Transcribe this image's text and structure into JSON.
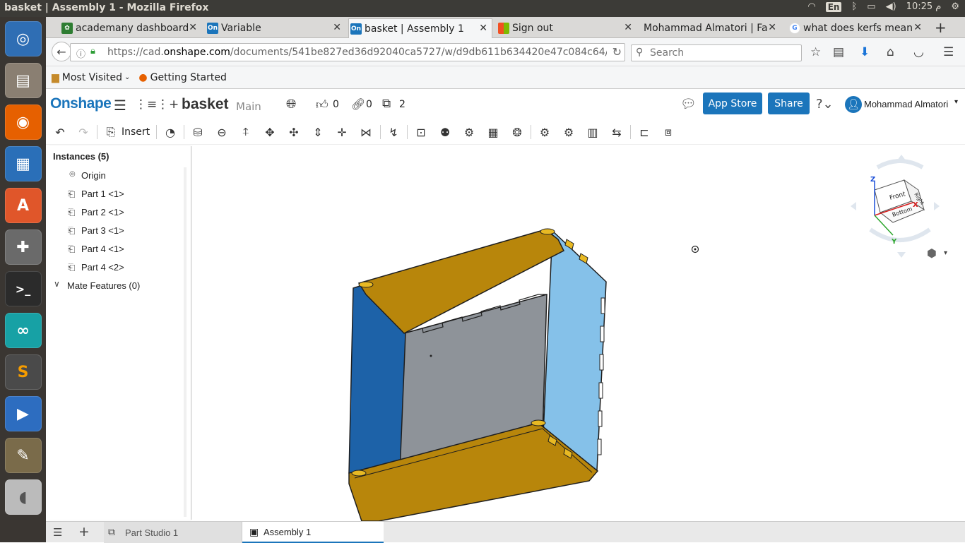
{
  "topbar": {
    "title": "basket | Assembly 1 - Mozilla Firefox",
    "lang": "En",
    "clock": "10:25 م"
  },
  "launcher": [
    "ubuntu-icon",
    "files-icon",
    "firefox-icon",
    "writer-icon",
    "software-center-icon",
    "settings-icon",
    "terminal-icon",
    "arduino-icon",
    "sublime-icon",
    "media-player-icon",
    "gimp-icon",
    "mouse-icon"
  ],
  "tabs": [
    {
      "label": "academany dashboard",
      "color": "#2e7d32"
    },
    {
      "label": "Variable",
      "color": "#1b75bb"
    },
    {
      "label": "basket | Assembly 1",
      "color": "#1b75bb"
    },
    {
      "label": "Sign out",
      "color": "#e44"
    },
    {
      "label": "Mohammad Almatori | Fa",
      "color": ""
    },
    {
      "label": "what does kerfs mean",
      "color": "#4285f4"
    }
  ],
  "nav": {
    "url_prefix": "https://cad.",
    "url_domain": "onshape.com",
    "url_rest": "/documents/541be827ed36d92040ca5727/w/d9db611b634420e47c084c64/",
    "search_placeholder": "Search"
  },
  "bookmarks": {
    "most_visited": "Most Visited",
    "getting_started": "Getting Started"
  },
  "onshape": {
    "logo": "Onshape",
    "doc_name": "basket",
    "branch": "Main",
    "likes": "0",
    "links": "0",
    "copies": "2",
    "app_store": "App Store",
    "share": "Share",
    "user": "Mohammad Almatori"
  },
  "toolbar": {
    "insert": "Insert"
  },
  "panel": {
    "instances_header": "Instances (5)",
    "origin": "Origin",
    "parts": [
      "Part 1 <1>",
      "Part 2 <1>",
      "Part 3 <1>",
      "Part 4 <1>",
      "Part 4 <2>"
    ],
    "mate_features": "Mate Features (0)"
  },
  "viewcube": {
    "z": "Z",
    "x": "X",
    "y": "Y",
    "front": "Front",
    "right": "Right",
    "bottom": "Bottom"
  },
  "bottom_tabs": {
    "part_studio": "Part Studio 1",
    "assembly": "Assembly 1"
  }
}
